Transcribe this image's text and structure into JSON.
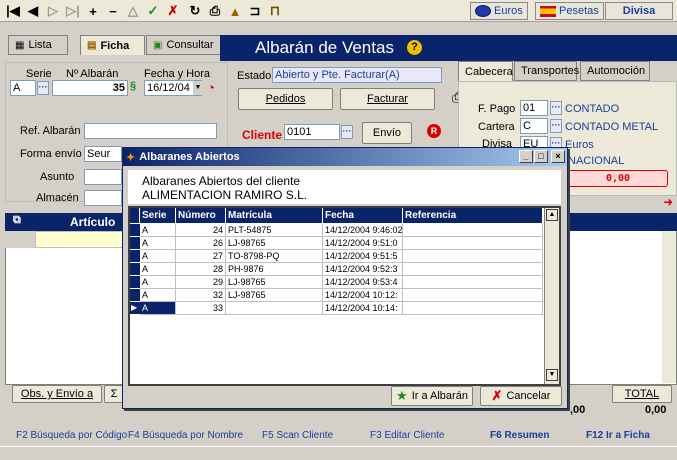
{
  "toolbar": {
    "euros_label": "Euros",
    "pesetas_label": "Pesetas",
    "divisa_label": "Divisa"
  },
  "tabs": [
    {
      "label": "Lista"
    },
    {
      "label": "Ficha"
    },
    {
      "label": "Consultar"
    }
  ],
  "window_title": "Albarán de Ventas",
  "header": {
    "serie_label": "Serie",
    "serie_value": "A",
    "num_label": "Nº Albarán",
    "num_value": "35",
    "fecha_label": "Fecha y Hora",
    "fecha_value": "16/12/04",
    "estado_label": "Estado",
    "estado_value": "Abierto y Pte. Facturar(A)",
    "pedidos_label": "Pedidos",
    "facturar_label": "Facturar",
    "ref_label": "Ref. Albarán",
    "ref_value": "",
    "cliente_label": "Cliente",
    "cliente_value": "0101",
    "envio_label": "Envío",
    "forma_envio_label": "Forma envío",
    "forma_envio_value": "Seur",
    "asunto_label": "Asunto",
    "almacen_label": "Almacén"
  },
  "right_tabs": [
    {
      "label": "Cabecera"
    },
    {
      "label": "Transportes"
    },
    {
      "label": "Automoción"
    }
  ],
  "cabecera": {
    "fpago_label": "F. Pago",
    "fpago_code": "01",
    "fpago_desc": "CONTADO",
    "cartera_label": "Cartera",
    "cartera_code": "C",
    "cartera_desc": "CONTADO METAL",
    "divisa_label": "Divisa",
    "divisa_code": "EU",
    "divisa_desc": "Euros",
    "nacional_desc": "NACIONAL",
    "amount_value": "0,00"
  },
  "grid": {
    "articulo_header": "Artículo"
  },
  "bottom": {
    "obs_label": "Obs. y Envío a",
    "sigma_label": "Σ",
    "total_label": "TOTAL",
    "left_amount": ",00",
    "total_value": "0,00"
  },
  "status_keys": [
    "F2 Búsqueda por Código",
    "F4 Búsqueda por Nombre",
    "F5 Scan Cliente",
    "F3 Editar Cliente",
    "F6 Resumen",
    "F12 Ir a Ficha"
  ],
  "dialog": {
    "title": "Albaranes Abiertos",
    "heading_line1": "Albaranes Abiertos del cliente",
    "heading_line2": "ALIMENTACION RAMIRO  S.L.",
    "columns": [
      "Serie",
      "Número",
      "Matrícula",
      "Fecha",
      "Referencia"
    ],
    "rows": [
      {
        "serie": "A",
        "numero": "24",
        "matricula": "PLT-54875",
        "fecha": "14/12/2004 9:46:02",
        "referencia": ""
      },
      {
        "serie": "A",
        "numero": "26",
        "matricula": "LJ-98765",
        "fecha": "14/12/2004 9:51:0",
        "referencia": ""
      },
      {
        "serie": "A",
        "numero": "27",
        "matricula": "TO-8798-PQ",
        "fecha": "14/12/2004 9:51:5",
        "referencia": ""
      },
      {
        "serie": "A",
        "numero": "28",
        "matricula": "PH-9876",
        "fecha": "14/12/2004 9:52:3",
        "referencia": ""
      },
      {
        "serie": "A",
        "numero": "29",
        "matricula": "LJ-98765",
        "fecha": "14/12/2004 9:53:4",
        "referencia": ""
      },
      {
        "serie": "A",
        "numero": "32",
        "matricula": "LJ-98765",
        "fecha": "14/12/2004 10:12:",
        "referencia": ""
      },
      {
        "serie": "A",
        "numero": "33",
        "matricula": "",
        "fecha": "14/12/2004 10:14:",
        "referencia": ""
      }
    ],
    "ir_label": "Ir a Albarán",
    "cancelar_label": "Cancelar",
    "win_min": "_",
    "win_max": "□",
    "win_close": "×"
  }
}
